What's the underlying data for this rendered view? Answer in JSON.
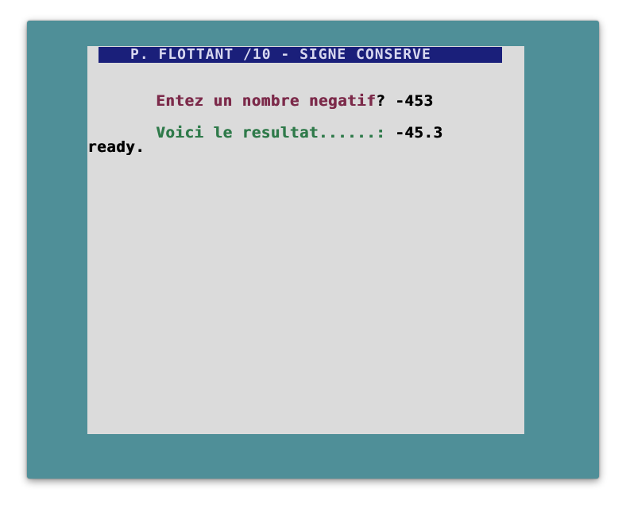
{
  "screen": {
    "title": "P. FLOTTANT /10 - SIGNE CONSERVE",
    "prompt_label": "Entez un nombre negatif",
    "prompt_mark": "?",
    "prompt_value": "-453",
    "result_label": "Voici le resultat......:",
    "result_value": "-45.3",
    "status": "ready."
  },
  "colors": {
    "border": "#4f8f98",
    "background": "#dbdbdb",
    "title_bar": "#1a1f7a",
    "prompt_text": "#7c2a4a",
    "result_text": "#2f7a4a"
  }
}
